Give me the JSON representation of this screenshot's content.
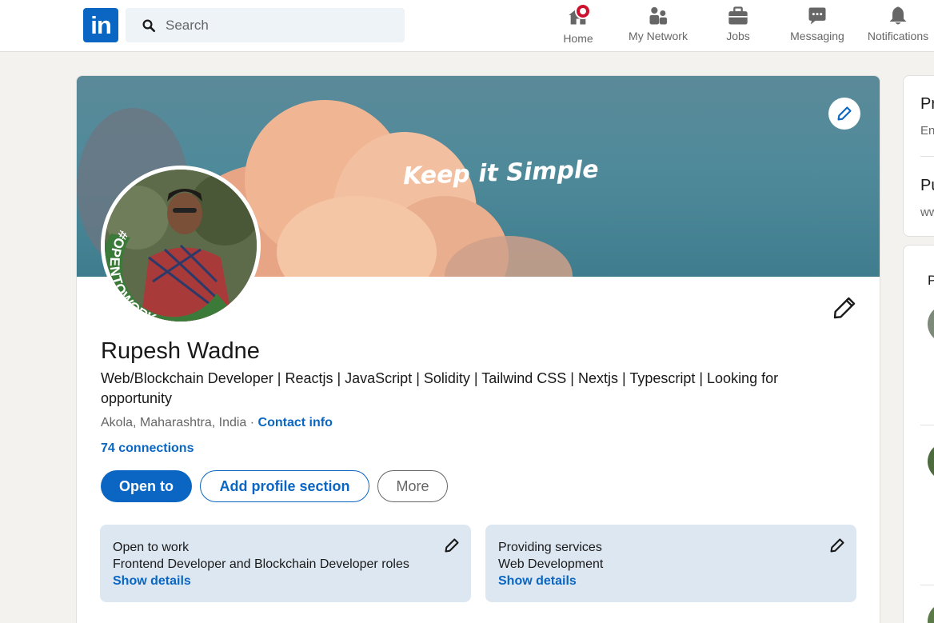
{
  "nav": {
    "logo": "in",
    "search_placeholder": "Search",
    "items": [
      {
        "label": "Home",
        "icon": "home-icon"
      },
      {
        "label": "My Network",
        "icon": "network-icon"
      },
      {
        "label": "Jobs",
        "icon": "briefcase-icon"
      },
      {
        "label": "Messaging",
        "icon": "messaging-icon"
      },
      {
        "label": "Notifications",
        "icon": "bell-icon"
      }
    ]
  },
  "banner": {
    "text": "Keep it Simple"
  },
  "avatar": {
    "ring_text": "#OPENTOWORK"
  },
  "profile": {
    "name": "Rupesh Wadne",
    "headline": "Web/Blockchain Developer | Reactjs | JavaScript | Solidity | Tailwind CSS | Nextjs | Typescript | Looking for opportunity",
    "location": "Akola, Maharashtra, India",
    "separator": " · ",
    "contact_info": "Contact info",
    "connections": "74 connections"
  },
  "actions": {
    "open_to": "Open to",
    "add_section": "Add profile section",
    "more": "More"
  },
  "open_to_work": {
    "title": "Open to work",
    "desc": "Frontend Developer and Blockchain Developer roles",
    "link": "Show details"
  },
  "services": {
    "title": "Providing services",
    "desc": "Web Development",
    "link": "Show details"
  },
  "right": {
    "card1_title1": "Pr",
    "card1_sub1": "En",
    "card1_title2": "Pu",
    "card1_sub2": "ww",
    "card2_title": "P"
  },
  "colors": {
    "brand": "#0a66c2",
    "badge": "#cb112d",
    "otw_green": "#3c7a3a"
  }
}
